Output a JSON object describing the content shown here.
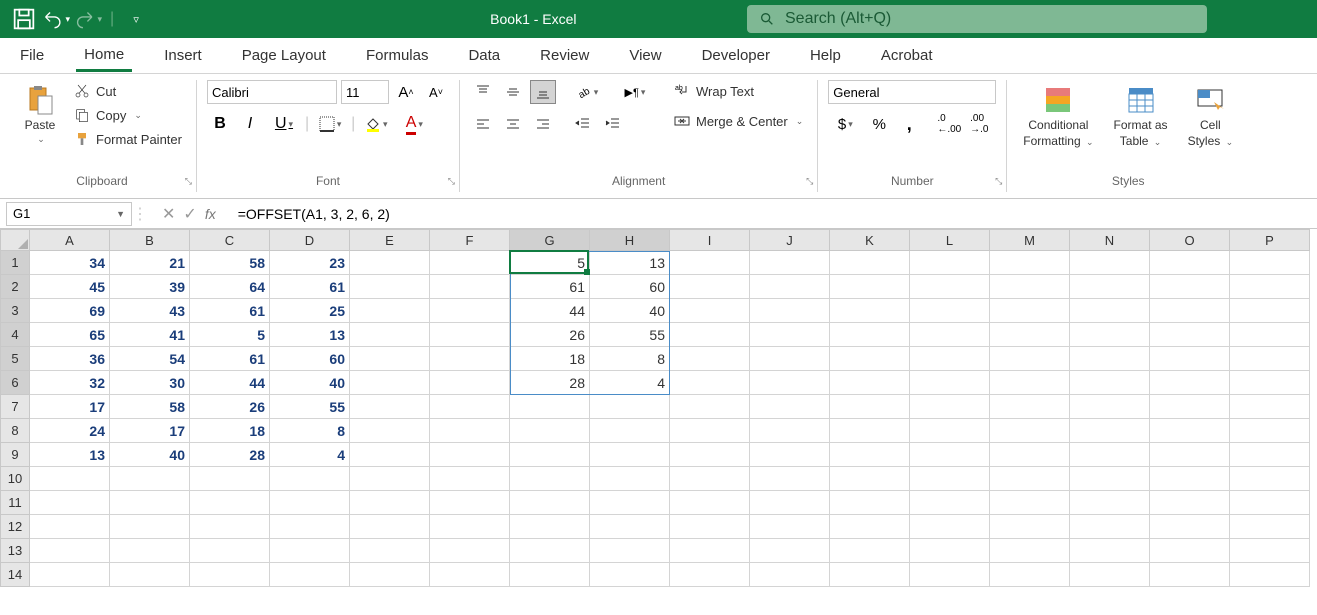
{
  "title": "Book1 - Excel",
  "search": {
    "placeholder": "Search (Alt+Q)"
  },
  "tabs": {
    "file": "File",
    "home": "Home",
    "insert": "Insert",
    "page_layout": "Page Layout",
    "formulas": "Formulas",
    "data": "Data",
    "review": "Review",
    "view": "View",
    "developer": "Developer",
    "help": "Help",
    "acrobat": "Acrobat"
  },
  "clipboard": {
    "paste": "Paste",
    "cut": "Cut",
    "copy": "Copy",
    "format_painter": "Format Painter",
    "label": "Clipboard"
  },
  "font": {
    "name": "Calibri",
    "size": "11",
    "label": "Font"
  },
  "alignment": {
    "wrap": "Wrap Text",
    "merge": "Merge & Center",
    "label": "Alignment"
  },
  "number": {
    "format": "General",
    "label": "Number"
  },
  "styles": {
    "conditional": "Conditional",
    "formatting": "Formatting",
    "format_as": "Format as",
    "table": "Table",
    "cell": "Cell",
    "styles_word": "Styles",
    "label": "Styles"
  },
  "name_box": "G1",
  "formula": "=OFFSET(A1, 3, 2, 6, 2)",
  "columns": [
    "A",
    "B",
    "C",
    "D",
    "E",
    "F",
    "G",
    "H",
    "I",
    "J",
    "K",
    "L",
    "M",
    "N",
    "O",
    "P"
  ],
  "rows": [
    "1",
    "2",
    "3",
    "4",
    "5",
    "6",
    "7",
    "8",
    "9",
    "10",
    "11",
    "12",
    "13",
    "14"
  ],
  "data_left": [
    [
      "34",
      "21",
      "58",
      "23"
    ],
    [
      "45",
      "39",
      "64",
      "61"
    ],
    [
      "69",
      "43",
      "61",
      "25"
    ],
    [
      "65",
      "41",
      "5",
      "13"
    ],
    [
      "36",
      "54",
      "61",
      "60"
    ],
    [
      "32",
      "30",
      "44",
      "40"
    ],
    [
      "17",
      "58",
      "26",
      "55"
    ],
    [
      "24",
      "17",
      "18",
      "8"
    ],
    [
      "13",
      "40",
      "28",
      "4"
    ]
  ],
  "data_right": [
    [
      "5",
      "13"
    ],
    [
      "61",
      "60"
    ],
    [
      "44",
      "40"
    ],
    [
      "26",
      "55"
    ],
    [
      "18",
      "8"
    ],
    [
      "28",
      "4"
    ]
  ],
  "active_cell": "G1"
}
